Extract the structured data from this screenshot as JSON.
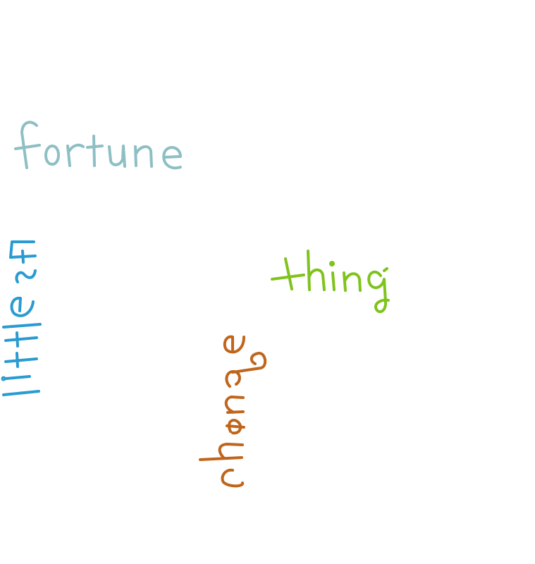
{
  "words": [
    {
      "id": "fortune",
      "text": "fortune",
      "color": "#8dbfc4",
      "orientation": "horizontal"
    },
    {
      "id": "littlest",
      "text": "littlest",
      "color": "#2a9bd2",
      "orientation": "vertical"
    },
    {
      "id": "thing",
      "text": "thing",
      "color": "#7fc31c",
      "orientation": "horizontal"
    },
    {
      "id": "change",
      "text": "change",
      "color": "#c0651b",
      "orientation": "vertical"
    }
  ]
}
